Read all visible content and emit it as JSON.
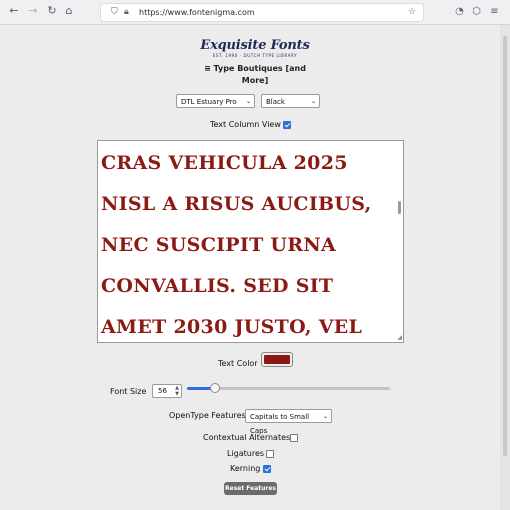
{
  "browser": {
    "url": "https://www.fontenigma.com",
    "icons": {
      "back": "arrow-left-icon",
      "forward": "arrow-right-icon",
      "reload": "reload-icon",
      "home": "home-icon",
      "shield": "shield-icon",
      "lock": "lock-icon",
      "bookmark": "star-icon",
      "pocket": "pocket-icon",
      "extensions": "extensions-icon",
      "menu": "hamburger-menu-icon"
    }
  },
  "header": {
    "logo_title": "Exquisite Fonts",
    "logo_subtitle": "EST. 1990 · DUTCH TYPE LIBRARY",
    "boutiques_label": "≡ Type Boutiques [and More]"
  },
  "controls": {
    "font_select": "DTL Estuary Pro",
    "weight_select": "Black",
    "text_column_view_label": "Text Column View",
    "text_column_view_checked": true,
    "sample_text": "CRAS VEHICULA 2025\nNISL A RISUS AUCIBUS,\nNEC SUSCIPIT URNA\nCONVALLIS. SED SIT\nAMET 2030 JUSTO, VEL",
    "text_color_label": "Text Color",
    "text_color": "#8b1a14",
    "font_size_label": "Font Size",
    "font_size_value": "56",
    "font_size_slider_fraction": 0.14,
    "opentype_label": "OpenType Features",
    "opentype_select": "Capitals to Small Caps",
    "features": [
      {
        "label": "Contextual Alternates",
        "checked": false
      },
      {
        "label": "Ligatures",
        "checked": false
      },
      {
        "label": "Kerning",
        "checked": true
      }
    ],
    "reset_label": "Reset Features"
  },
  "colors": {
    "accent": "#2a6fdb",
    "brand": "#1f2a5a"
  }
}
